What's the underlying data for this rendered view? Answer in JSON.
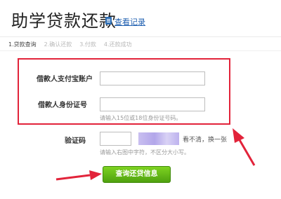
{
  "header": {
    "title": "助学贷款还款",
    "record_link": "查看记录"
  },
  "steps": [
    {
      "label": "1.贷款查询",
      "active": true
    },
    {
      "label": "2.确认还款",
      "active": false
    },
    {
      "label": "3.付款",
      "active": false
    },
    {
      "label": "4.还款成功",
      "active": false
    }
  ],
  "form": {
    "alipay_label": "借款人支付宝账户",
    "alipay_value": "",
    "id_label": "借款人身份证号",
    "id_value": "",
    "id_hint": "请输入15位或18位身份证号码。",
    "captcha_label": "验证码",
    "captcha_value": "",
    "captcha_refresh": "看不清，换一张",
    "captcha_hint": "请输入右图中字符，不区分大小写。"
  },
  "submit_label": "查询还贷信息",
  "colors": {
    "highlight_box": "#e2233a",
    "arrow": "#e2233a",
    "button": "#5cb214",
    "link": "#1f5fb0"
  }
}
